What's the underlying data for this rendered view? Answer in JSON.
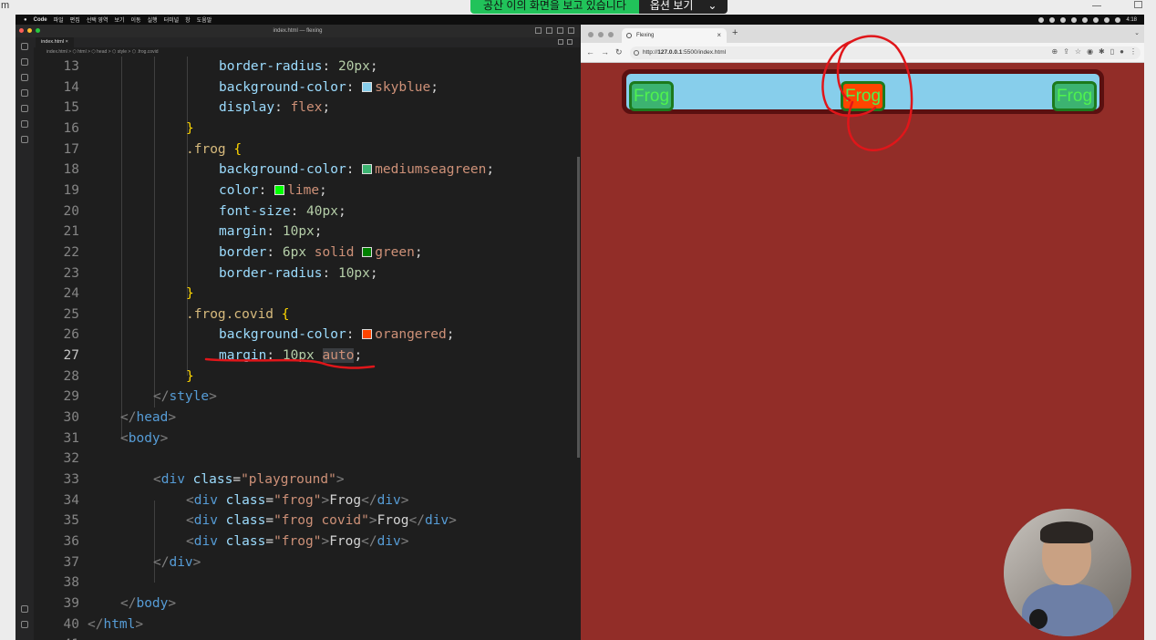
{
  "top": {
    "letter": "m"
  },
  "share_banner": {
    "message": "공산 이의 화면을 보고 있습니다",
    "options_label": "옵션 보기",
    "chevron": "⌄"
  },
  "macbar": {
    "app": "Code",
    "menus": [
      "파일",
      "편집",
      "선택 영역",
      "보기",
      "이동",
      "실행",
      "터미널",
      "창",
      "도움말"
    ],
    "time": "4:18"
  },
  "vscode": {
    "title": "index.html — flexing",
    "tab": "index.html",
    "breadcrumb": "index.html > ⬡ html > ⬡ head > ⬡ style > ⬡ .frog.covid"
  },
  "lines": [
    {
      "n": "13"
    },
    {
      "n": "14"
    },
    {
      "n": "15"
    },
    {
      "n": "16"
    },
    {
      "n": "17"
    },
    {
      "n": "18"
    },
    {
      "n": "19"
    },
    {
      "n": "20"
    },
    {
      "n": "21"
    },
    {
      "n": "22"
    },
    {
      "n": "23"
    },
    {
      "n": "24"
    },
    {
      "n": "25"
    },
    {
      "n": "26"
    },
    {
      "n": "27"
    },
    {
      "n": "28"
    },
    {
      "n": "29"
    },
    {
      "n": "30"
    },
    {
      "n": "31"
    },
    {
      "n": "32"
    },
    {
      "n": "33"
    },
    {
      "n": "34"
    },
    {
      "n": "35"
    },
    {
      "n": "36"
    },
    {
      "n": "37"
    },
    {
      "n": "38"
    },
    {
      "n": "39"
    },
    {
      "n": "40"
    },
    {
      "n": "41"
    }
  ],
  "code": {
    "l13": {
      "prop": "border-radius",
      "num": "20px"
    },
    "l14": {
      "prop": "background-color",
      "val": "skyblue",
      "swatch": "#87ceeb"
    },
    "l15": {
      "prop": "display",
      "val": "flex"
    },
    "l16": {
      "brace": "}"
    },
    "l17": {
      "sel": ".frog",
      "brace": "{"
    },
    "l18": {
      "prop": "background-color",
      "val": "mediumseagreen",
      "swatch": "#3cb371"
    },
    "l19": {
      "prop": "color",
      "val": "lime",
      "swatch": "#00ff00"
    },
    "l20": {
      "prop": "font-size",
      "num": "40px"
    },
    "l21": {
      "prop": "margin",
      "num": "10px"
    },
    "l22": {
      "prop": "border",
      "num": "6px",
      "val": "solid",
      "val2": "green",
      "swatch": "#008000"
    },
    "l23": {
      "prop": "border-radius",
      "num": "10px"
    },
    "l24": {
      "brace": "}"
    },
    "l25": {
      "sel": ".frog.covid",
      "brace": "{"
    },
    "l26": {
      "prop": "background-color",
      "val": "orangered",
      "swatch": "#ff4500"
    },
    "l27": {
      "prop": "margin",
      "num": "10px",
      "val": "auto"
    },
    "l28": {
      "brace": "}"
    },
    "l29": {
      "tag": "style"
    },
    "l30": {
      "tag": "head"
    },
    "l31": {
      "tag": "body"
    },
    "l33": {
      "tag": "div",
      "attr": "class",
      "str": "\"playground\""
    },
    "l34": {
      "tag": "div",
      "attr": "class",
      "str": "\"frog\"",
      "text": "Frog"
    },
    "l35": {
      "tag": "div",
      "attr": "class",
      "str": "\"frog covid\"",
      "text": "Frog"
    },
    "l36": {
      "tag": "div",
      "attr": "class",
      "str": "\"frog\"",
      "text": "Frog"
    },
    "l37": {
      "tag": "div"
    },
    "l39": {
      "tag": "body"
    },
    "l40": {
      "tag": "html"
    }
  },
  "browser": {
    "tab_title": "Flexing",
    "url_prefix": "http://",
    "url_host": "127.0.0.1",
    "url_rest": ":5500/index.html",
    "new_tab": "+",
    "close": "×",
    "nav_back": "←",
    "nav_forward": "→",
    "nav_reload": "↻",
    "frogs": [
      "Frog",
      "Frog",
      "Frog"
    ],
    "colors": {
      "page_bg": "#922d28",
      "playground": "#87ceeb",
      "frog": "#3cb371",
      "covid": "#ff4500",
      "frog_text": "#00ff00"
    }
  },
  "icons": {
    "lock": "lock-icon",
    "star": "star-icon",
    "zoom": "zoom-icon",
    "share": "share-icon",
    "extension": "puzzle-icon",
    "profile": "avatar-icon"
  }
}
